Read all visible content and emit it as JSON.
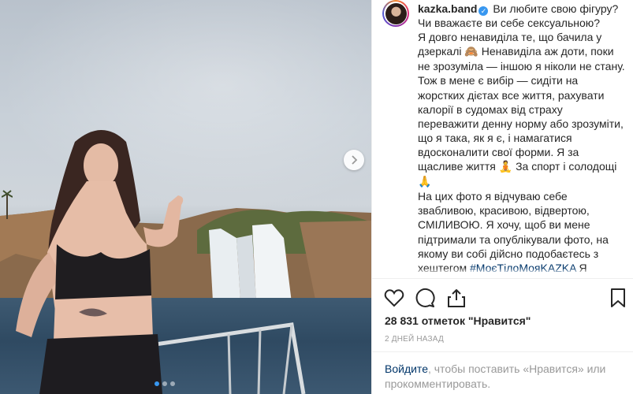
{
  "post": {
    "username": "kazka.band",
    "verified": true,
    "caption_lines": [
      "Ви любите свою фігуру? Чи вважаєте ви себе сексуальною?",
      "Я довго ненавиділа те, що бачила у дзеркалі",
      "Ненавиділа аж доти, поки не зрозуміла — іншою я ніколи не стану. Тож в мене є вибір — сидіти на жорстких дієтах все життя, рахувати калорії в судомах від страху переважити денну норму або зрозуміти, що я така, як я є, і намагатися вдосконалити свої форми. Я за щасливе життя",
      "За спорт і солодощі",
      "На цих фото я відчуваю себе звабливою, красивою, відвертою, СМІЛИВОЮ. Я хочу, щоб ви мене підтримали та опублікували фото, на якому ви собі дійсно подобаєтесь з хештегом",
      "#МоєТілоМояKAZKA",
      "Я"
    ],
    "emoji": {
      "mirror": "🙈",
      "happy": "🧘",
      "pray": "🙏"
    },
    "likes_text": "28 831 отметок \"Нравится\"",
    "time_ago": "2 дней назад",
    "login_link": "Войдите",
    "login_rest": ", чтобы поставить «Нравится» или прокомментировать."
  },
  "carousel": {
    "dot_count": 3,
    "active_dot": 0
  },
  "icons": {
    "like": "heart-icon",
    "comment": "comment-icon",
    "share": "share-icon",
    "save": "bookmark-icon",
    "next": "chevron-right-icon",
    "verified": "verified-badge-icon"
  },
  "colors": {
    "link": "#003569",
    "verified": "#3897f0",
    "muted": "#999999",
    "text": "#262626"
  }
}
